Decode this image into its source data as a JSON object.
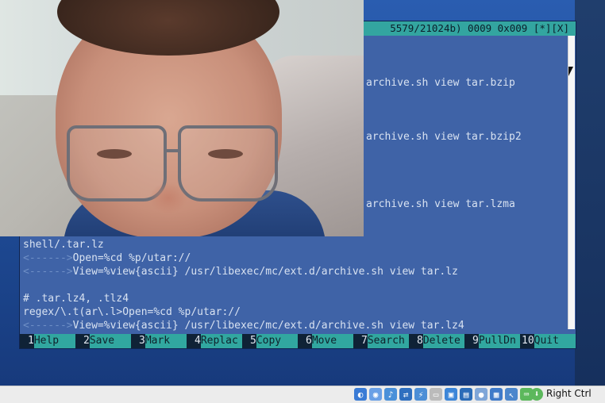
{
  "editor": {
    "status": "5579/21024b) 0009 0x009 [*][X]",
    "lines": [
      {
        "indent": "",
        "text": ""
      },
      {
        "indent": "",
        "text": ""
      },
      {
        "indent": "",
        "text": ""
      },
      {
        "indent": "",
        "text": "archive.sh view tar.bzip"
      },
      {
        "indent": "",
        "text": ""
      },
      {
        "indent": "",
        "text": ""
      },
      {
        "indent": "",
        "text": ""
      },
      {
        "indent": "",
        "text": "archive.sh view tar.bzip2"
      },
      {
        "indent": "",
        "text": ""
      },
      {
        "indent": "",
        "text": ""
      },
      {
        "indent": "",
        "text": ""
      },
      {
        "indent": "",
        "text": ""
      },
      {
        "indent": "",
        "text": "archive.sh view tar.lzma"
      },
      {
        "indent": "",
        "text": ""
      },
      {
        "indent": "",
        "text": ""
      },
      {
        "indent": "",
        "text": "shell/.tar.lz"
      },
      {
        "indent": "<------>",
        "text": "Open=%cd %p/utar://"
      },
      {
        "indent": "<------>",
        "text": "View=%view{ascii} /usr/libexec/mc/ext.d/archive.sh view tar.lz"
      },
      {
        "indent": "",
        "text": ""
      },
      {
        "indent": "",
        "text": "# .tar.lz4, .tlz4"
      },
      {
        "indent": "",
        "text": "regex/\\.t(ar\\.l>Open=%cd %p/utar://"
      },
      {
        "indent": "<------>",
        "text": "View=%view{ascii} /usr/libexec/mc/ext.d/archive.sh view tar.lz4"
      }
    ],
    "fkeys": [
      {
        "num": "1",
        "label": "Help"
      },
      {
        "num": "2",
        "label": "Save"
      },
      {
        "num": "3",
        "label": "Mark"
      },
      {
        "num": "4",
        "label": "Replac"
      },
      {
        "num": "5",
        "label": "Copy"
      },
      {
        "num": "6",
        "label": "Move"
      },
      {
        "num": "7",
        "label": "Search"
      },
      {
        "num": "8",
        "label": "Delete"
      },
      {
        "num": "9",
        "label": "PullDn"
      },
      {
        "num": "10",
        "label": "Quit"
      }
    ]
  },
  "statusbar": {
    "host_key": "Right Ctrl",
    "icons": [
      "optical-drive-icon",
      "cd-icon",
      "audio-icon",
      "network-icon",
      "usb-icon",
      "shared-folder-icon",
      "display-icon",
      "screen-icon",
      "recording-icon",
      "cpu-icon",
      "mouse-integration-icon",
      "keyboard-icon"
    ]
  }
}
